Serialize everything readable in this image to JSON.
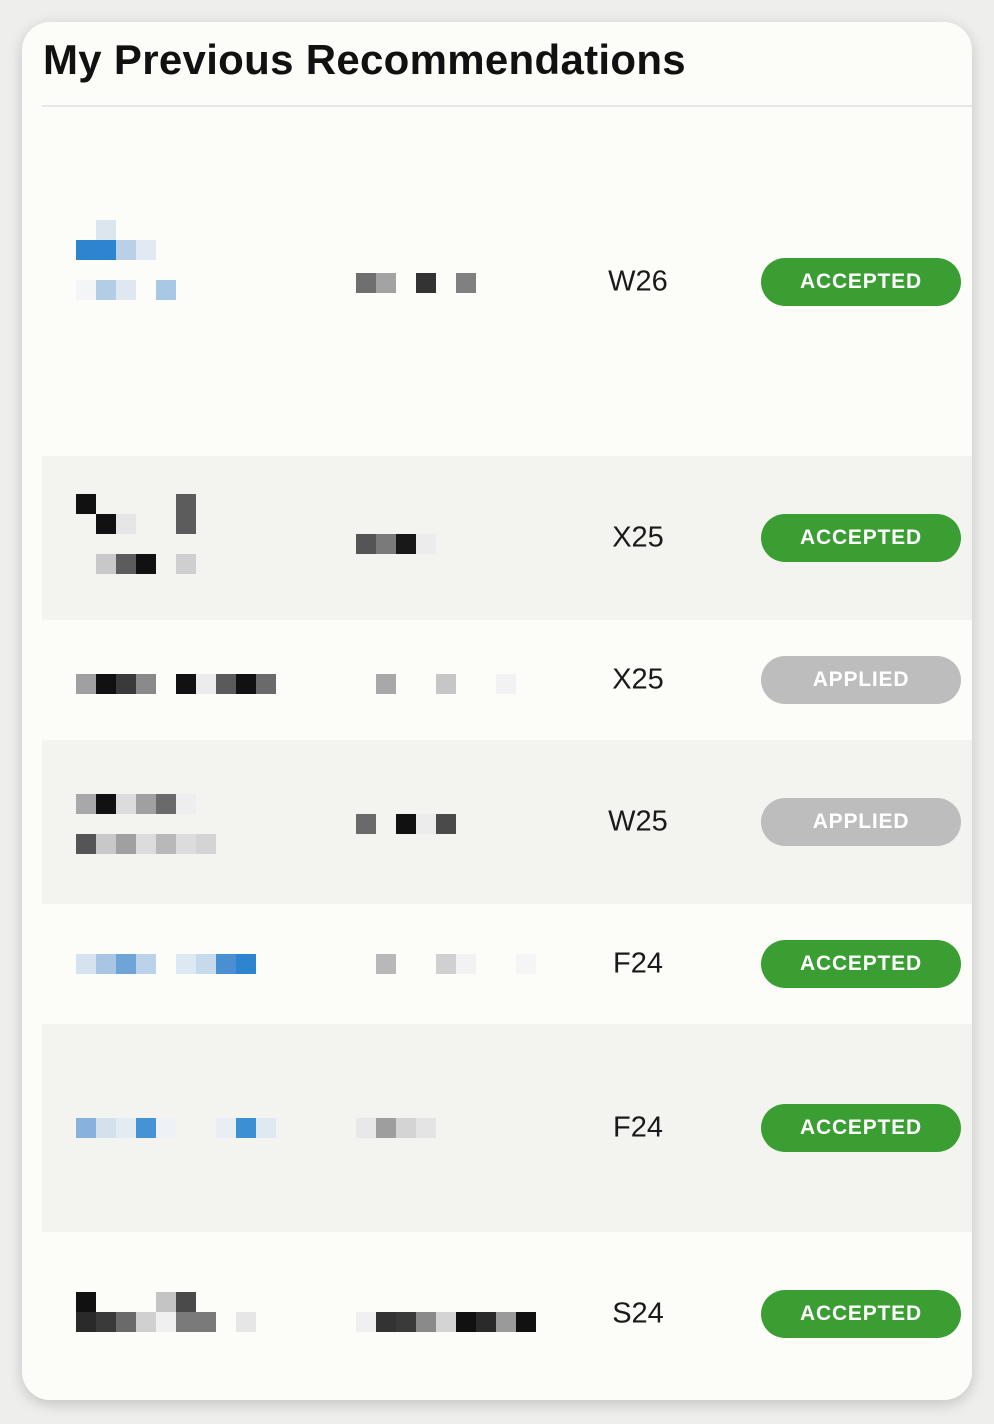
{
  "header": {
    "title": "My Previous Recommendations"
  },
  "colors": {
    "accepted": "#3a9e32",
    "applied": "#bdbdbd",
    "row_alt": "#f3f3f0",
    "card": "#fcfcf9"
  },
  "recommendations": [
    {
      "term": "W26",
      "status": "ACCEPTED"
    },
    {
      "term": "X25",
      "status": "ACCEPTED"
    },
    {
      "term": "X25",
      "status": "APPLIED"
    },
    {
      "term": "W25",
      "status": "APPLIED"
    },
    {
      "term": "F24",
      "status": "ACCEPTED"
    },
    {
      "term": "F24",
      "status": "ACCEPTED"
    },
    {
      "term": "S24",
      "status": "ACCEPTED"
    }
  ]
}
